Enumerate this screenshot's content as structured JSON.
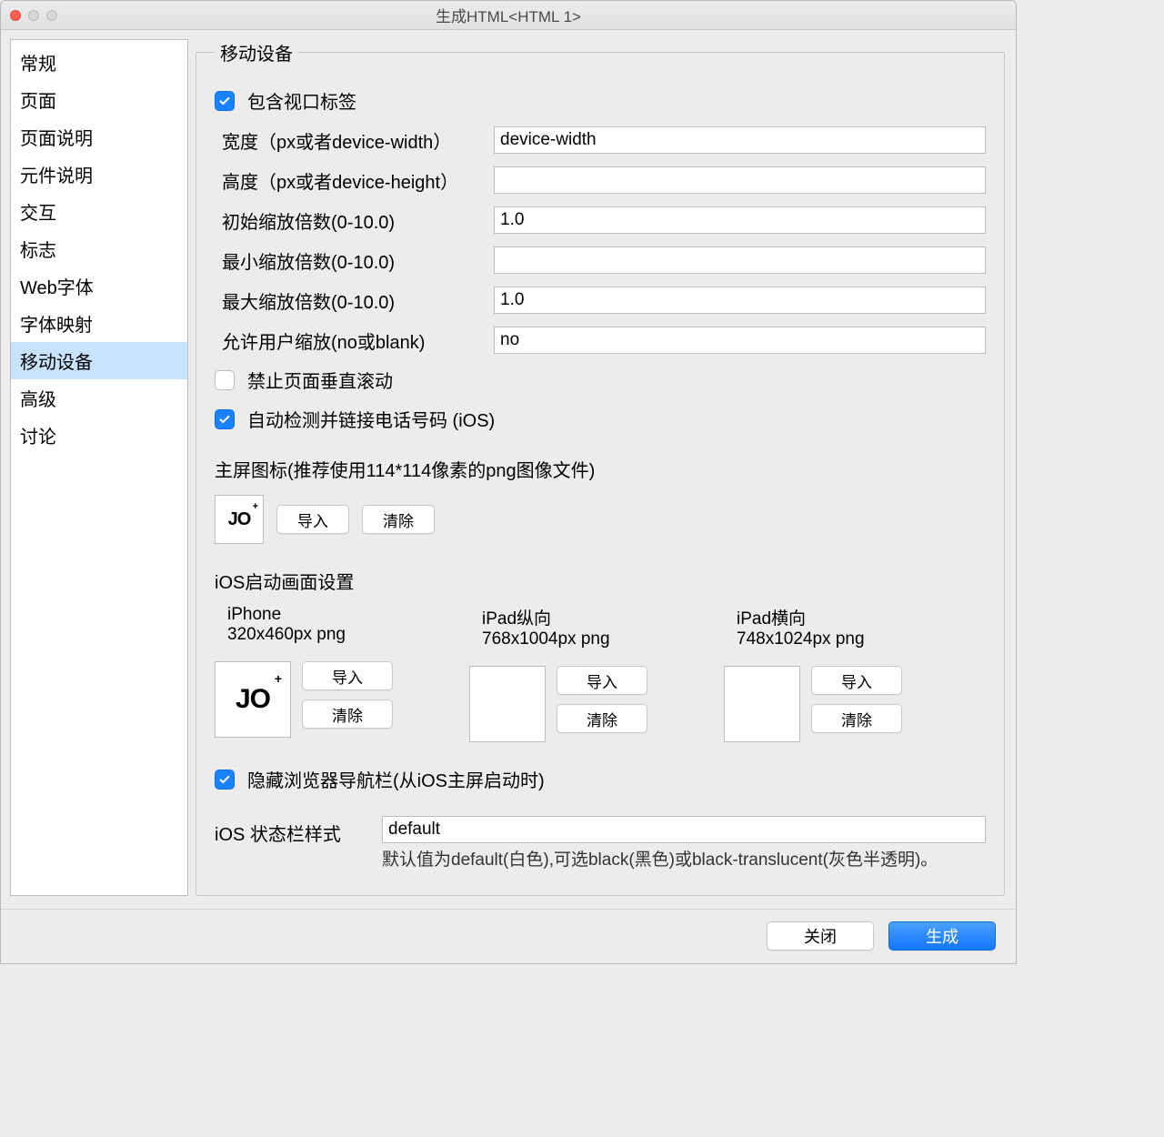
{
  "window": {
    "title": "生成HTML<HTML 1>"
  },
  "sidebar": {
    "items": [
      {
        "label": "常规"
      },
      {
        "label": "页面"
      },
      {
        "label": "页面说明"
      },
      {
        "label": "元件说明"
      },
      {
        "label": "交互"
      },
      {
        "label": "标志"
      },
      {
        "label": "Web字体"
      },
      {
        "label": "字体映射"
      },
      {
        "label": "移动设备"
      },
      {
        "label": "高级"
      },
      {
        "label": "讨论"
      }
    ],
    "selected_index": 8
  },
  "group": {
    "legend": "移动设备",
    "include_viewport": {
      "checked": true,
      "label": "包含视口标签"
    },
    "width": {
      "label": "宽度（px或者device-width）",
      "value": "device-width"
    },
    "height": {
      "label": "高度（px或者device-height）",
      "value": ""
    },
    "initial_scale": {
      "label": "初始缩放倍数(0-10.0)",
      "value": "1.0"
    },
    "min_scale": {
      "label": "最小缩放倍数(0-10.0)",
      "value": ""
    },
    "max_scale": {
      "label": "最大缩放倍数(0-10.0)",
      "value": "1.0"
    },
    "user_scalable": {
      "label": "允许用户缩放(no或blank)",
      "value": "no"
    },
    "prevent_vscroll": {
      "checked": false,
      "label": "禁止页面垂直滚动"
    },
    "auto_phone": {
      "checked": true,
      "label": "自动检测并链接电话号码 (iOS)"
    },
    "home_icon_label": "主屏图标(推荐使用114*114像素的png图像文件)",
    "import_label": "导入",
    "clear_label": "清除",
    "splash_label": "iOS启动画面设置",
    "splash": [
      {
        "title": "iPhone",
        "dim": "320x460px png",
        "has_image": true
      },
      {
        "title": "iPad纵向",
        "dim": "768x1004px png",
        "has_image": false
      },
      {
        "title": "iPad横向",
        "dim": "748x1024px png",
        "has_image": false
      }
    ],
    "hide_nav": {
      "checked": true,
      "label": "隐藏浏览器导航栏(从iOS主屏启动时)"
    },
    "status_bar": {
      "label": "iOS 状态栏样式",
      "value": "default",
      "help": "默认值为default(白色),可选black(黑色)或black-translucent(灰色半透明)。"
    }
  },
  "footer": {
    "close": "关闭",
    "generate": "生成"
  },
  "thumb_text": "JO",
  "thumb_plus": "+"
}
